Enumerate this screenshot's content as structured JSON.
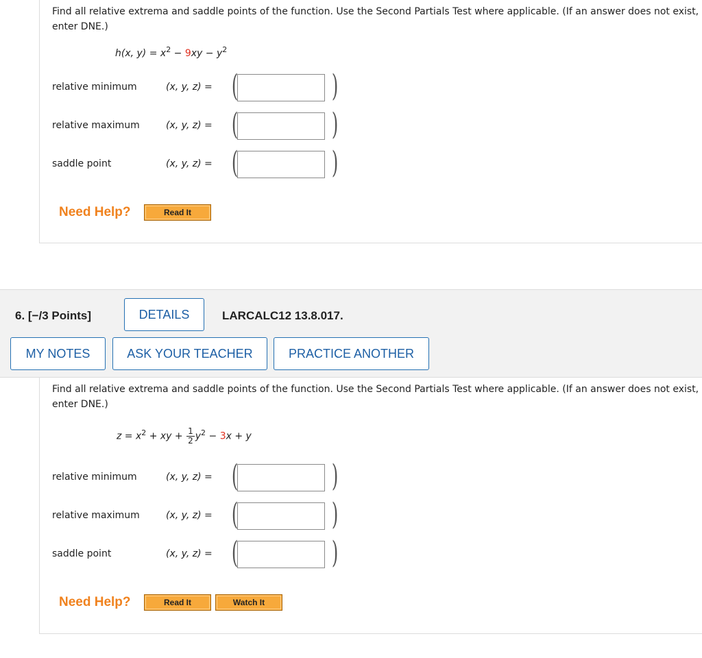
{
  "problem5": {
    "prompt": "Find all relative extrema and saddle points of the function. Use the Second Partials Test where applicable. (If an answer does not exist, enter DNE.)",
    "function_prefix": "h(x, y) = x",
    "exp1": "2",
    "op1": " − ",
    "red_term": "9",
    "mid_term": "xy − y",
    "exp2": "2",
    "rows": [
      {
        "label": "relative minimum",
        "coord": "(x, y, z)",
        "equals": "="
      },
      {
        "label": "relative maximum",
        "coord": "(x, y, z)",
        "equals": "="
      },
      {
        "label": "saddle point",
        "coord": "(x, y, z)",
        "equals": "="
      }
    ],
    "need_help": "Need Help?",
    "read_it": "Read It"
  },
  "question6": {
    "number": "6. [−/3 Points]",
    "details": "DETAILS",
    "code": "LARCALC12 13.8.017.",
    "my_notes": "MY NOTES",
    "ask_teacher": "ASK YOUR TEACHER",
    "practice_another": "PRACTICE ANOTHER"
  },
  "problem6": {
    "prompt": "Find all relative extrema and saddle points of the function. Use the Second Partials Test where applicable. (If an answer does not exist, enter DNE.)",
    "lhs": "z = x",
    "exp1": "2",
    "term2": " + xy + ",
    "frac_num": "1",
    "frac_den": "2",
    "term3": "y",
    "exp3": "2",
    "op": " − ",
    "red_term": "3",
    "tail": "x + y",
    "rows": [
      {
        "label": "relative minimum",
        "coord": "(x, y, z)",
        "equals": "="
      },
      {
        "label": "relative maximum",
        "coord": "(x, y, z)",
        "equals": "="
      },
      {
        "label": "saddle point",
        "coord": "(x, y, z)",
        "equals": "="
      }
    ],
    "need_help": "Need Help?",
    "read_it": "Read It",
    "watch_it": "Watch It"
  }
}
